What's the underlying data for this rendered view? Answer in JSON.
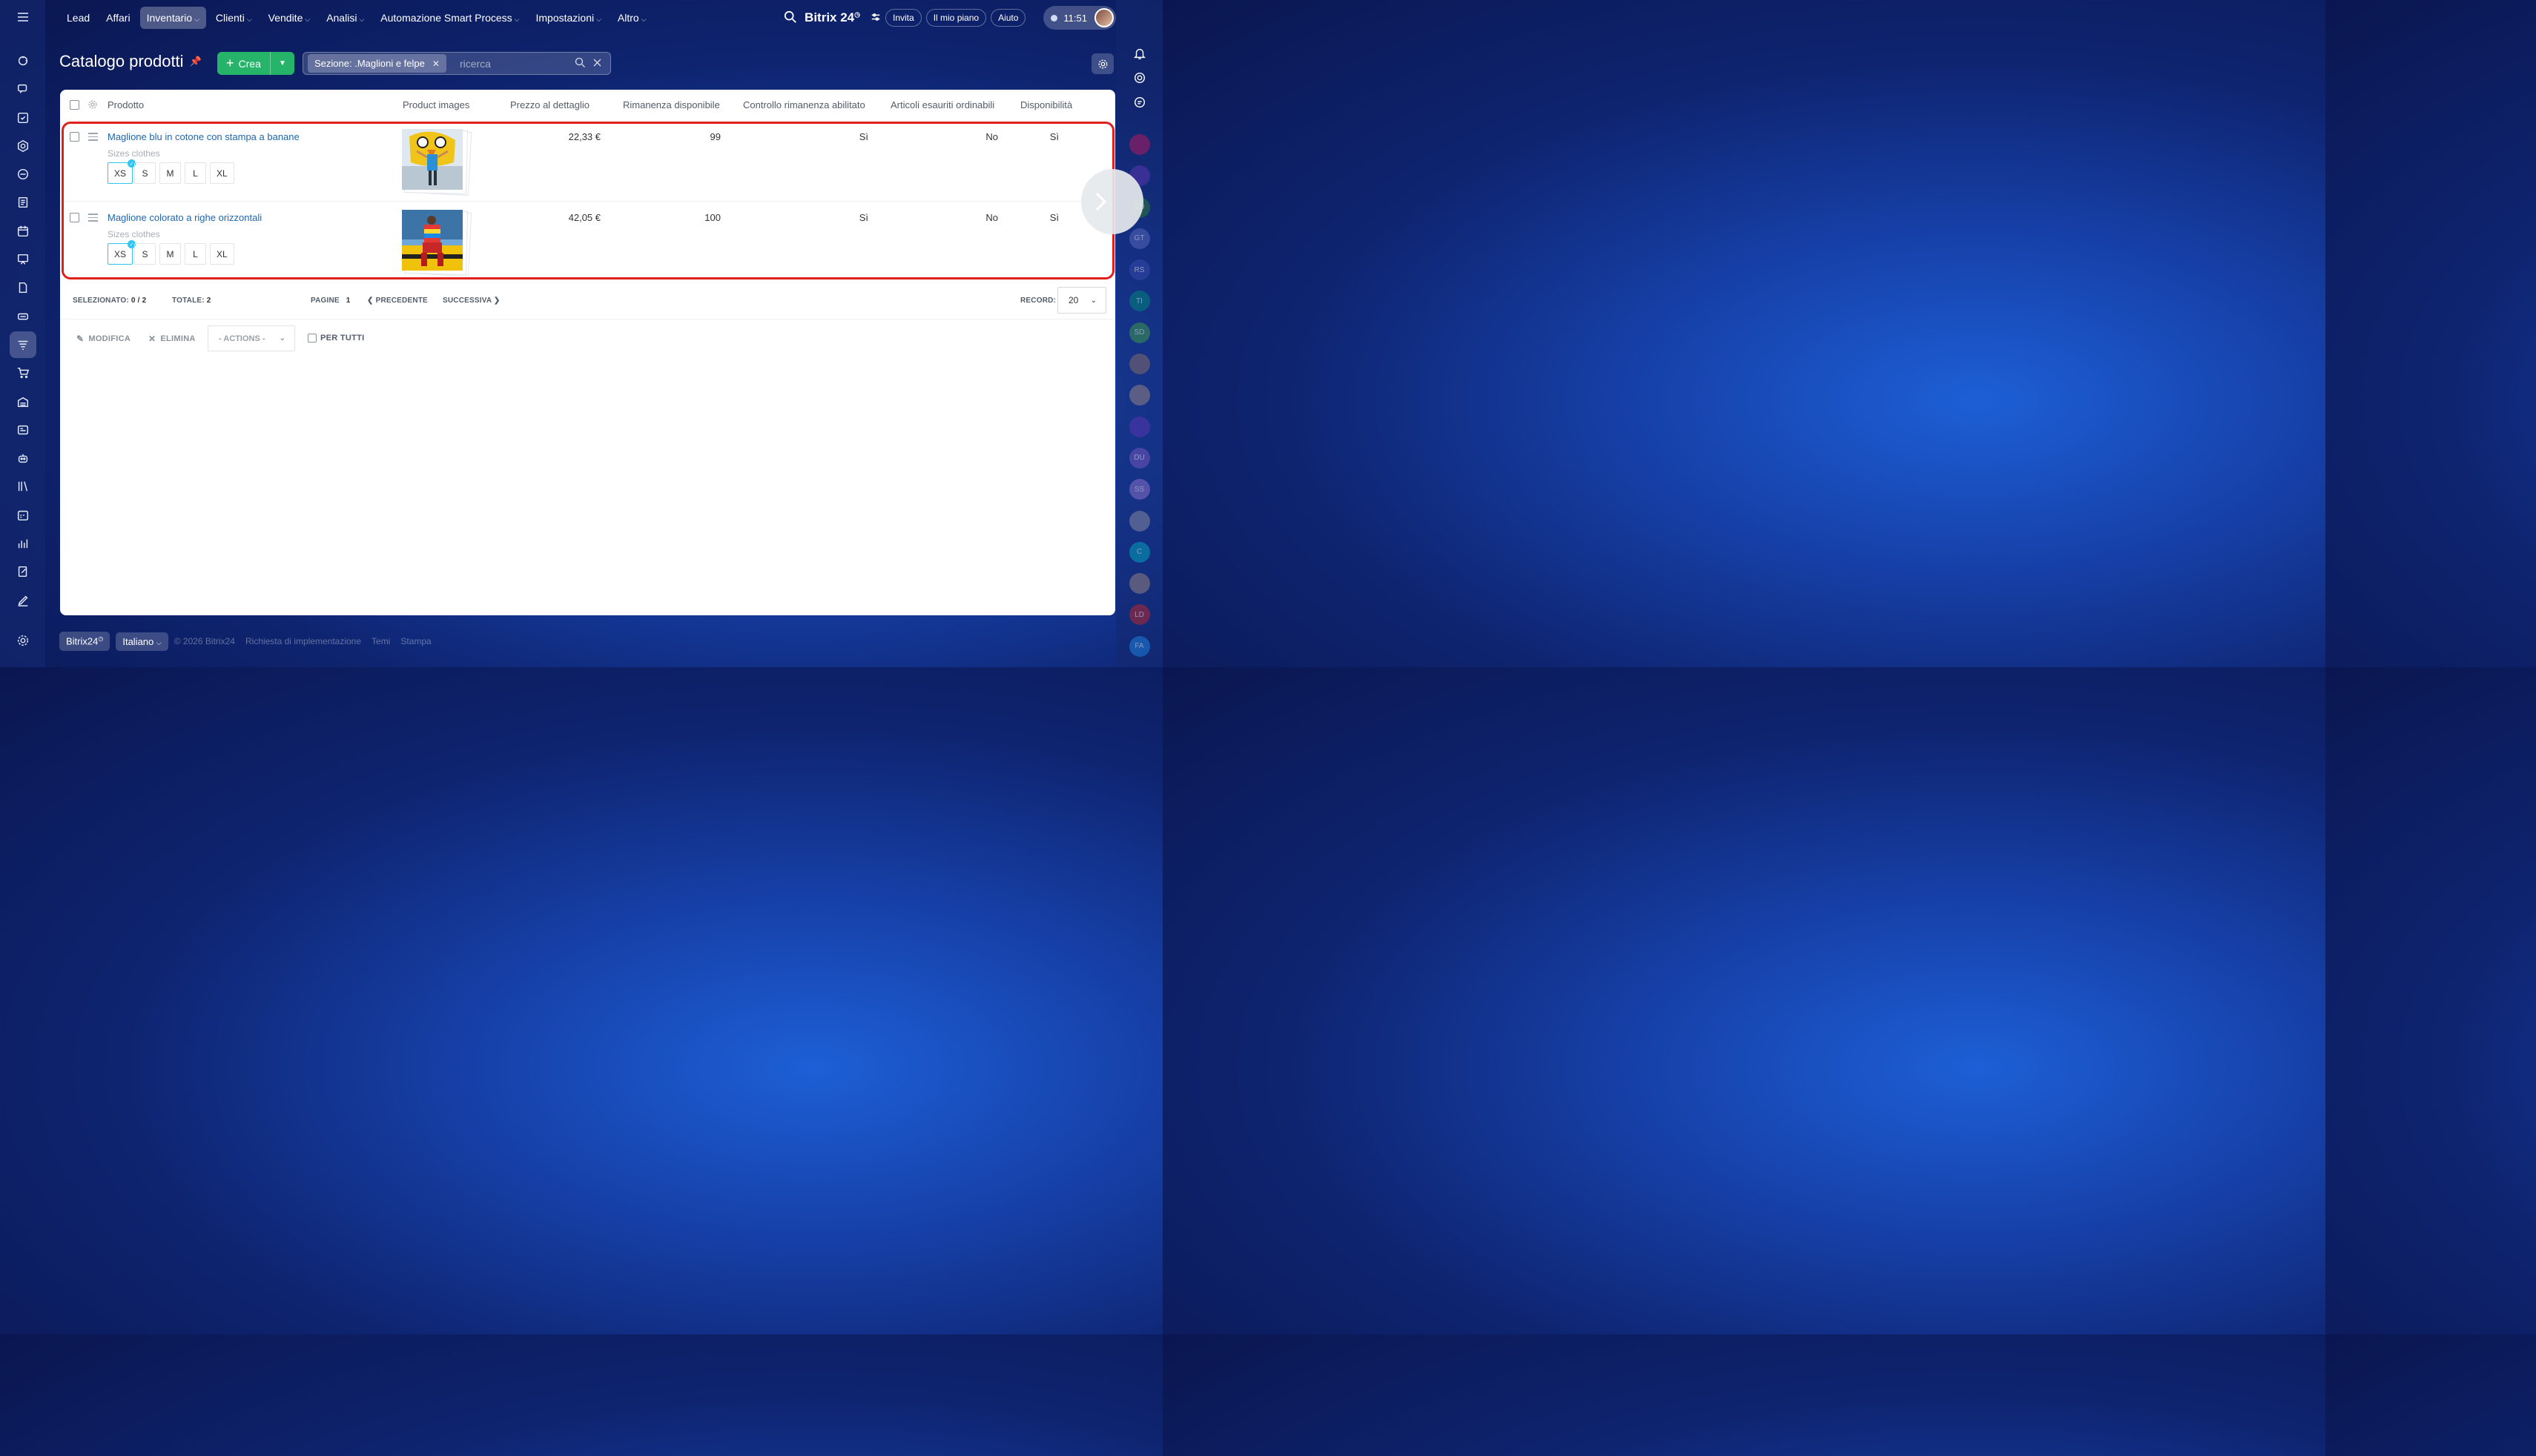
{
  "app": {
    "brand": "Bitrix 24",
    "time": "11:51"
  },
  "top_nav": {
    "items": [
      {
        "label": "Lead",
        "has_dropdown": false
      },
      {
        "label": "Affari",
        "has_dropdown": false
      },
      {
        "label": "Inventario",
        "has_dropdown": true,
        "active": true
      },
      {
        "label": "Clienti",
        "has_dropdown": true
      },
      {
        "label": "Vendite",
        "has_dropdown": true
      },
      {
        "label": "Analisi",
        "has_dropdown": true
      },
      {
        "label": "Automazione Smart Process",
        "has_dropdown": true
      },
      {
        "label": "Impostazioni",
        "has_dropdown": true
      },
      {
        "label": "Altro",
        "has_dropdown": true
      }
    ],
    "invite": "Invita",
    "my_plan": "Il mio piano",
    "help": "Aiuto"
  },
  "page": {
    "title": "Catalogo prodotti",
    "create_label": "Crea",
    "filter_tag": "Sezione: .Maglioni e felpe",
    "search_placeholder": "ricerca"
  },
  "table": {
    "columns": [
      "Prodotto",
      "Product images",
      "Prezzo al dettaglio",
      "Rimanenza disponibile",
      "Controllo rimanenza abilitato",
      "Articoli esauriti ordinabili",
      "Disponibilità"
    ],
    "sizes_label": "Sizes clothes",
    "sizes": [
      "XS",
      "S",
      "M",
      "L",
      "XL"
    ],
    "rows": [
      {
        "name": "Maglione blu in cotone con stampa a banane",
        "price": "22,33 €",
        "stock": "99",
        "stock_control": "Sì",
        "out_of_stock_orderable": "No",
        "availability": "Sì",
        "selected_size": "XS"
      },
      {
        "name": "Maglione colorato a righe orizzontali",
        "price": "42,05 €",
        "stock": "100",
        "stock_control": "Sì",
        "out_of_stock_orderable": "No",
        "availability": "Sì",
        "selected_size": "XS"
      }
    ]
  },
  "pager": {
    "selected_label": "SELEZIONATO:",
    "selected_value": "0 / 2",
    "total_label": "TOTALE:",
    "total_value": "2",
    "pages_label": "PAGINE",
    "page_number": "1",
    "prev": "PRECEDENTE",
    "next": "SUCCESSIVA",
    "records_label": "RECORD:",
    "records_value": "20"
  },
  "actions": {
    "edit": "MODIFICA",
    "delete": "ELIMINA",
    "actions_placeholder": "- ACTIONS -",
    "for_all": "PER TUTTI"
  },
  "footer": {
    "brand": "Bitrix24",
    "language": "Italiano",
    "copyright": "© 2026 Bitrix24",
    "implementation": "Richiesta di implementazione",
    "themes": "Temi",
    "print": "Stampa"
  },
  "right_bar": {
    "chat_initials": [
      "",
      "",
      "SD",
      "GT",
      "RS",
      "TI",
      "SD",
      "",
      "",
      "",
      "DU",
      "SS",
      "",
      "C",
      "",
      "LD",
      "FA"
    ],
    "chat_colors": [
      "#c2185b",
      "#5e35b1",
      "#2e7d32",
      "#5c6bc0",
      "#3949ab",
      "#00897b",
      "#43a047",
      "#8d6e63",
      "#a1887f",
      "#5e35b1",
      "#7e57c2",
      "#9575cd",
      "#8e8ea0",
      "#00acc1",
      "#a1887f",
      "#c62828",
      "#1e88e5"
    ]
  }
}
